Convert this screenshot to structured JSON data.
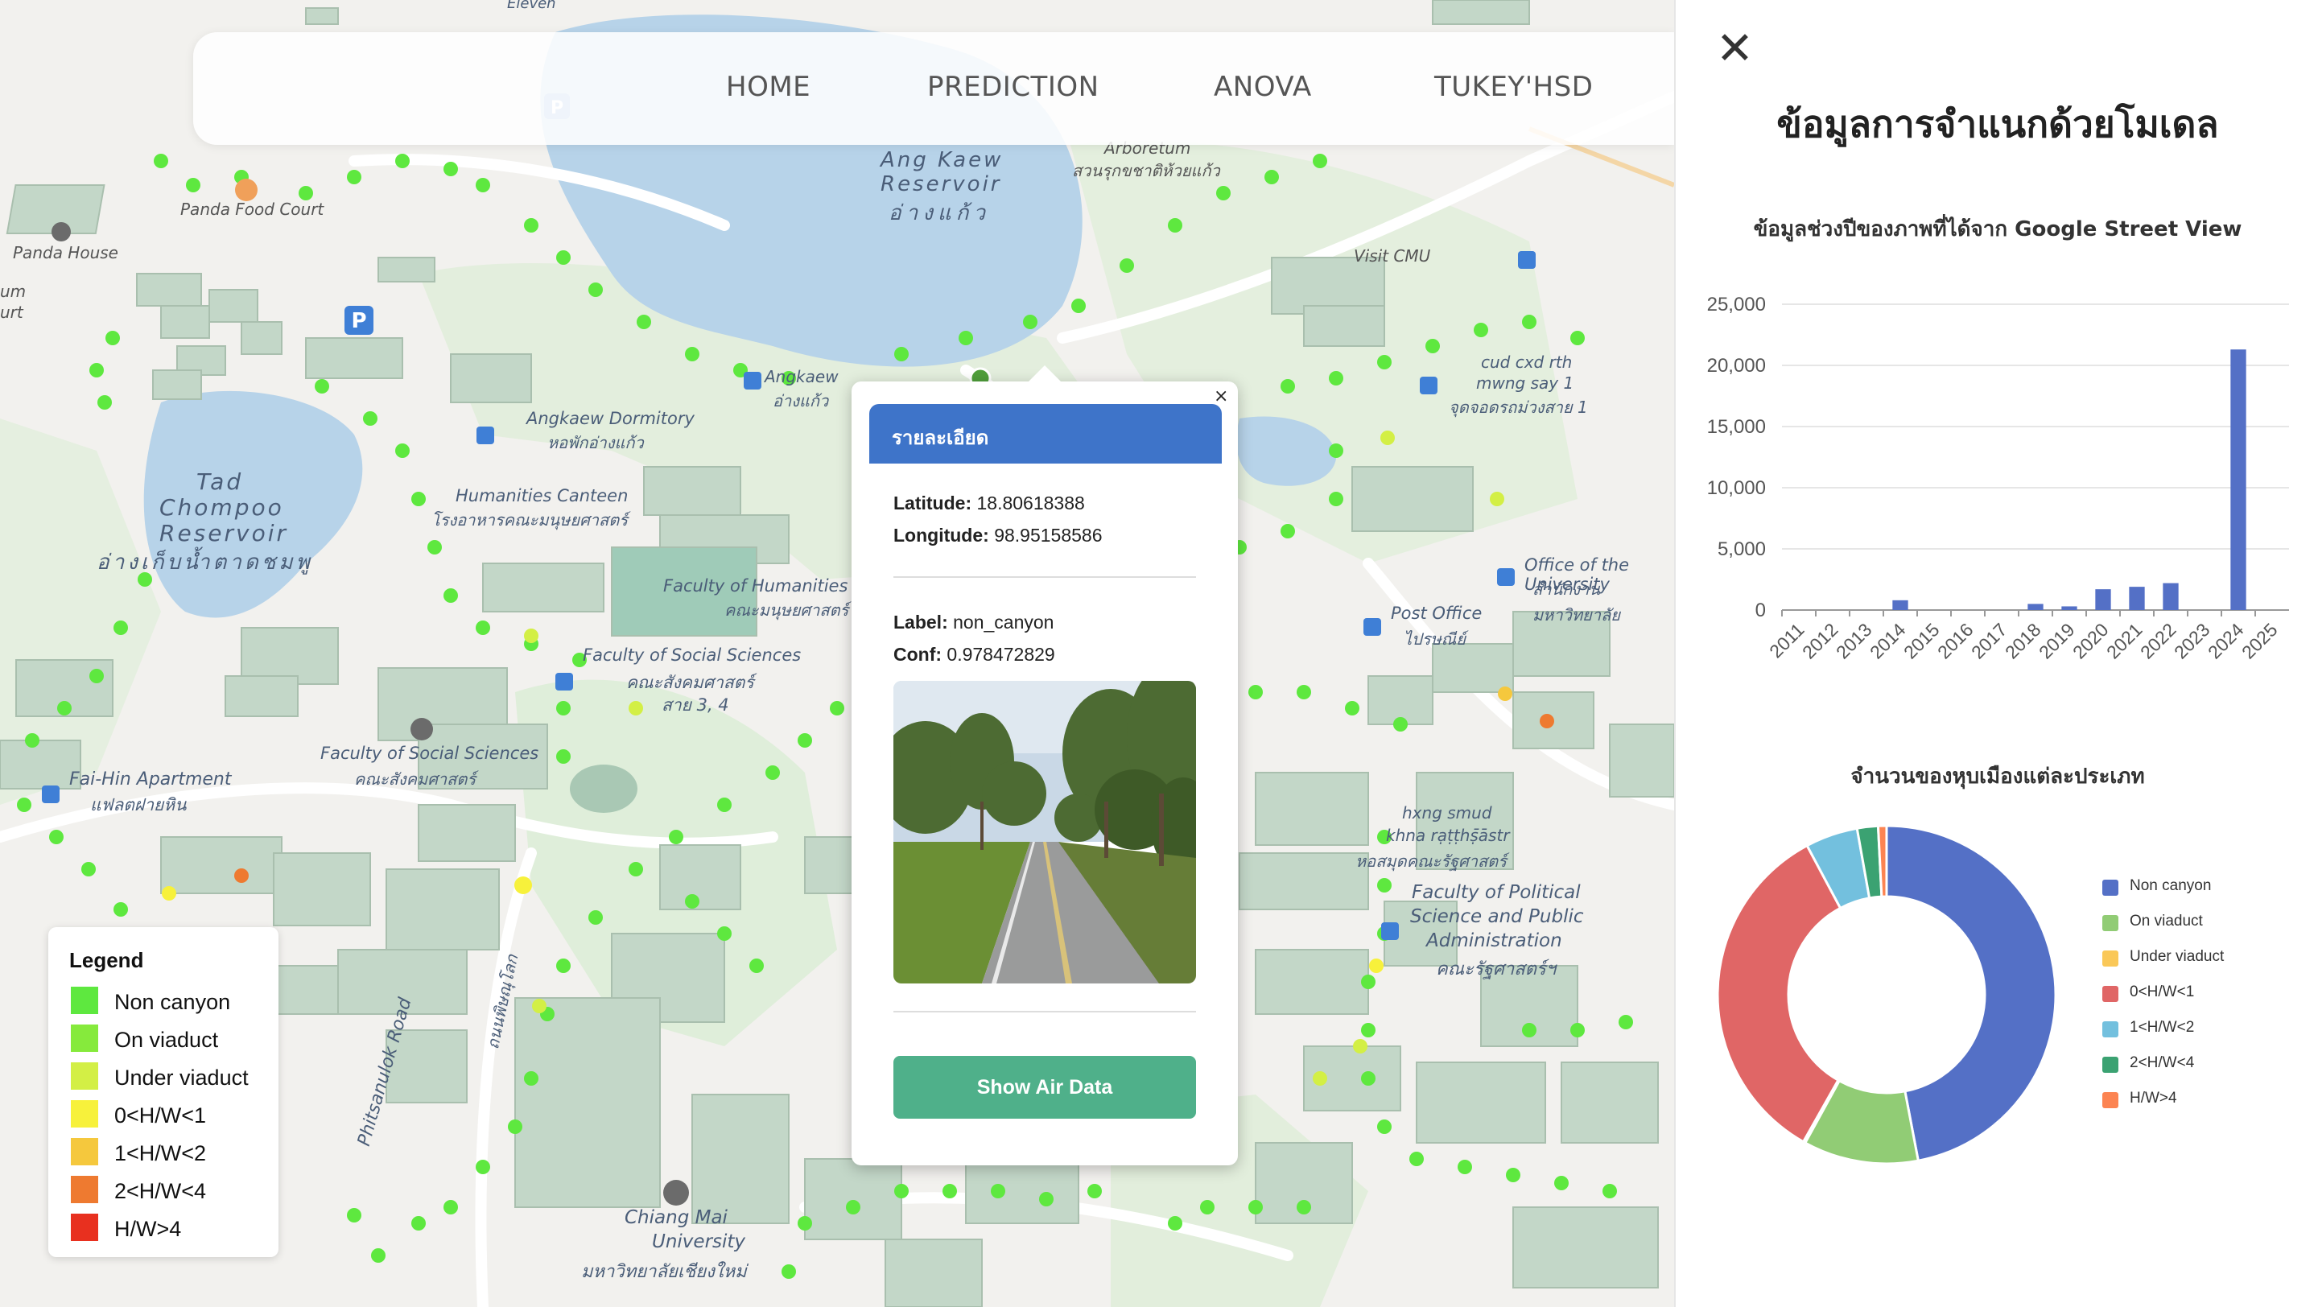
{
  "nav": {
    "home": "HOME",
    "prediction": "PREDICTION",
    "anova": "ANOVA",
    "tukey": "TUKEY'HSD"
  },
  "map_labels": {
    "eleven": "Eleven",
    "panda_food": "Panda Food Court",
    "panda_house": "Panda House",
    "um": "um",
    "urt": "urt",
    "ang_kaew_1": "Ang Kaew",
    "ang_kaew_2": "Reservoir",
    "ang_kaew_th": "อ่างแก้ว",
    "arboretum_1": "Arboretum",
    "arboretum_th": "สวนรุกขชาติห้วยแก้ว",
    "visit_cmu": "Visit CMU",
    "angkaew_bus": "Angkaew",
    "angkaew_bus_th": "อ่างแก้ว",
    "angkaew_dorm": "Angkaew Dormitory",
    "angkaew_dorm_th": "หอพักอ่างแก้ว",
    "tad_1": "Tad",
    "tad_2": "Chompoo",
    "tad_3": "Reservoir",
    "tad_th": "อ่างเก็บน้ำตาดชมพู",
    "canteen": "Humanities Canteen",
    "canteen_th": "โรงอาหารคณะมนุษยศาสตร์",
    "humanities": "Faculty of Humanities",
    "humanities_th": "คณะมนุษยศาสตร์",
    "social_th_1": "คณะสังคมศาสตร์",
    "social_th_2": "สาย 3, 4",
    "social_sci": "Faculty of Social Sciences",
    "social_sci_th": "คณะสังคมศาสตร์",
    "faihin": "Fai-Hin Apartment",
    "faihin_th": "แฟลตฝายหิน",
    "bus_label_1": "cud cxd rth",
    "bus_label_2": "mwng say 1",
    "bus_label_th": "จุดจอดรถม่วงสาย 1",
    "office": "Office of the University",
    "office_th": "สำนักงานมหาวิทยาลัย",
    "post": "Post Office",
    "post_th": "ไปรษณีย์",
    "polsci_1": "Faculty of Political",
    "polsci_2": "Science and Public",
    "polsci_3": "Administration",
    "polsci_th": "คณะรัฐศาสตร์ฯ",
    "library_1": "hxng smud",
    "library_2": "khna rạṭṭhṣ̄āstr",
    "library_th": "หอสมุดคณะรัฐศาสตร์",
    "cmu_1": "Chiang Mai",
    "cmu_2": "University",
    "cmu_th": "มหาวิทยาลัยเชียงใหม่",
    "road": "Phitsanulok Road",
    "road_th": "ถนนพิษณุโลก"
  },
  "legend": {
    "title": "Legend",
    "items": [
      {
        "label": "Non canyon",
        "color": "#5ee83f"
      },
      {
        "label": "On viaduct",
        "color": "#86ea3c"
      },
      {
        "label": "Under viaduct",
        "color": "#d3ef45"
      },
      {
        "label": "0<H/W<1",
        "color": "#f7f13b"
      },
      {
        "label": "1<H/W<2",
        "color": "#f5c83d"
      },
      {
        "label": "2<H/W<4",
        "color": "#ee7a30"
      },
      {
        "label": "H/W>4",
        "color": "#e8301f"
      }
    ]
  },
  "popup": {
    "close": "×",
    "header": "รายละเอียด",
    "latitude_label": "Latitude:",
    "latitude_value": "18.80618388",
    "longitude_label": "Longitude:",
    "longitude_value": "98.95158586",
    "label_label": "Label:",
    "label_value": "non_canyon",
    "conf_label": "Conf:",
    "conf_value": "0.978472829",
    "button": "Show Air Data"
  },
  "panel": {
    "close": "✕",
    "title": "ข้อมูลการจำแนกด้วยโมเดล",
    "bar_title": "ข้อมูลช่วงปีของภาพที่ได้จาก Google Street View",
    "pie_title": "จำนวนของหุบเมืองแต่ละประเภท"
  },
  "chart_data": [
    {
      "type": "bar",
      "title": "ข้อมูลช่วงปีของภาพที่ได้จาก Google Street View",
      "categories": [
        "2011",
        "2012",
        "2013",
        "2014",
        "2015",
        "2016",
        "2017",
        "2018",
        "2019",
        "2020",
        "2021",
        "2022",
        "2023",
        "2024",
        "2025"
      ],
      "values": [
        0,
        0,
        0,
        800,
        0,
        0,
        0,
        500,
        300,
        1700,
        1900,
        2200,
        0,
        21300,
        0
      ],
      "ylim": [
        0,
        25000
      ],
      "yticks": [
        "0",
        "5,000",
        "10,000",
        "15,000",
        "20,000",
        "25,000"
      ],
      "color": "#5470c6",
      "grid": true
    },
    {
      "type": "pie",
      "title": "จำนวนของหุบเมืองแต่ละประเภท",
      "donut": true,
      "slices": [
        {
          "label": "Non canyon",
          "value": 47,
          "color": "#5470c6"
        },
        {
          "label": "On viaduct",
          "value": 11,
          "color": "#91cc75"
        },
        {
          "label": "Under viaduct",
          "value": 0.2,
          "color": "#fac858"
        },
        {
          "label": "0<H/W<1",
          "value": 34,
          "color": "#e06666"
        },
        {
          "label": "1<H/W<2",
          "value": 5,
          "color": "#73c0de"
        },
        {
          "label": "2<H/W<4",
          "value": 2,
          "color": "#3ba272"
        },
        {
          "label": "H/W>4",
          "value": 0.8,
          "color": "#fc8452"
        }
      ],
      "legend_position": "right"
    }
  ]
}
